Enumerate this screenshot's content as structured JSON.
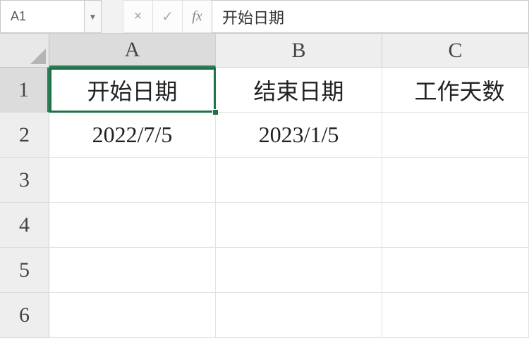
{
  "formula_bar": {
    "name_box": "A1",
    "cancel_glyph": "×",
    "enter_glyph": "✓",
    "fx_glyph": "fx",
    "formula_value": "开始日期"
  },
  "columns": {
    "A": "A",
    "B": "B",
    "C": "C"
  },
  "rows": {
    "r1": "1",
    "r2": "2",
    "r3": "3",
    "r4": "4",
    "r5": "5",
    "r6": "6"
  },
  "cells": {
    "A1": "开始日期",
    "B1": "结束日期",
    "C1": "工作天数",
    "A2": "2022/7/5",
    "B2": "2023/1/5",
    "C2": ""
  },
  "selection": {
    "cell": "A1"
  }
}
